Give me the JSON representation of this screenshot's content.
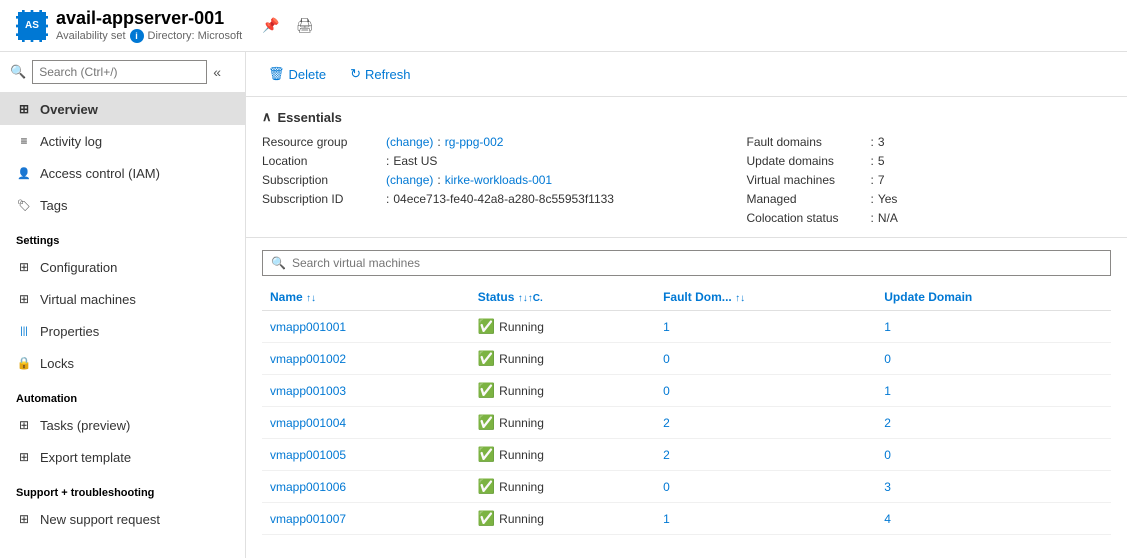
{
  "header": {
    "icon_label": "AS",
    "title": "avail-appserver-001",
    "subtitle_type": "Availability set",
    "subtitle_directory": "Directory: Microsoft"
  },
  "toolbar": {
    "delete_label": "Delete",
    "refresh_label": "Refresh"
  },
  "sidebar": {
    "search_placeholder": "Search (Ctrl+/)",
    "nav_items": [
      {
        "id": "overview",
        "label": "Overview",
        "icon": "⊞",
        "active": true
      },
      {
        "id": "activity-log",
        "label": "Activity log",
        "icon": "≡"
      },
      {
        "id": "access-control",
        "label": "Access control (IAM)",
        "icon": "👤"
      },
      {
        "id": "tags",
        "label": "Tags",
        "icon": "🏷"
      }
    ],
    "section_settings": "Settings",
    "settings_items": [
      {
        "id": "configuration",
        "label": "Configuration",
        "icon": "⊞"
      },
      {
        "id": "virtual-machines",
        "label": "Virtual machines",
        "icon": "⊞"
      },
      {
        "id": "properties",
        "label": "Properties",
        "icon": "|||"
      },
      {
        "id": "locks",
        "label": "Locks",
        "icon": "🔒"
      }
    ],
    "section_automation": "Automation",
    "automation_items": [
      {
        "id": "tasks-preview",
        "label": "Tasks (preview)",
        "icon": "⊞"
      },
      {
        "id": "export-template",
        "label": "Export template",
        "icon": "⊞"
      }
    ],
    "section_support": "Support + troubleshooting",
    "support_items": [
      {
        "id": "new-support-request",
        "label": "New support request",
        "icon": "⊞"
      }
    ]
  },
  "essentials": {
    "header_label": "Essentials",
    "left": [
      {
        "label": "Resource group",
        "change_link": "(change)",
        "value": "rg-ppg-002"
      },
      {
        "label": "Location",
        "value": "East US"
      },
      {
        "label": "Subscription",
        "change_link": "(change)",
        "value": "kirke-workloads-001"
      },
      {
        "label": "Subscription ID",
        "value": "04ece713-fe40-42a8-a280-8c55953f1133"
      }
    ],
    "right": [
      {
        "label": "Fault domains",
        "value": "3"
      },
      {
        "label": "Update domains",
        "value": "5"
      },
      {
        "label": "Virtual machines",
        "value": "7"
      },
      {
        "label": "Managed",
        "value": "Yes"
      },
      {
        "label": "Colocation status",
        "value": "N/A"
      }
    ]
  },
  "vm_table": {
    "search_placeholder": "Search virtual machines",
    "columns": [
      {
        "id": "name",
        "label": "Name",
        "sortable": true
      },
      {
        "id": "status",
        "label": "Status",
        "sortable": true
      },
      {
        "id": "fault-domain",
        "label": "Fault Dom...",
        "sortable": true
      },
      {
        "id": "update-domain",
        "label": "Update Domain",
        "sortable": false
      }
    ],
    "rows": [
      {
        "name": "vmapp001001",
        "status": "Running",
        "fault_domain": "1",
        "update_domain": "1"
      },
      {
        "name": "vmapp001002",
        "status": "Running",
        "fault_domain": "0",
        "update_domain": "0"
      },
      {
        "name": "vmapp001003",
        "status": "Running",
        "fault_domain": "0",
        "update_domain": "1"
      },
      {
        "name": "vmapp001004",
        "status": "Running",
        "fault_domain": "2",
        "update_domain": "2"
      },
      {
        "name": "vmapp001005",
        "status": "Running",
        "fault_domain": "2",
        "update_domain": "0"
      },
      {
        "name": "vmapp001006",
        "status": "Running",
        "fault_domain": "0",
        "update_domain": "3"
      },
      {
        "name": "vmapp001007",
        "status": "Running",
        "fault_domain": "1",
        "update_domain": "4"
      }
    ]
  }
}
